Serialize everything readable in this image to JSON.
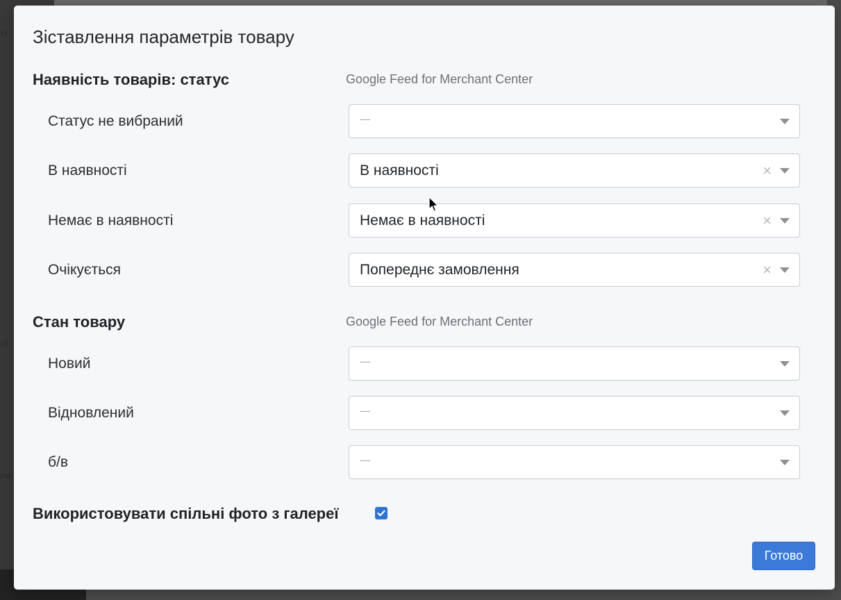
{
  "backdrop": {
    "edge_text_1": "ті",
    "edge_text_2": "лі",
    "edge_text_3": "ри"
  },
  "modal": {
    "title": "Зіставлення параметрів товару",
    "availability_section": {
      "title": "Наявність товарів: статус",
      "source": "Google Feed for Merchant Center",
      "rows": [
        {
          "label": "Статус не вибраний",
          "value": "",
          "placeholder": "----"
        },
        {
          "label": "В наявності",
          "value": "В наявності",
          "placeholder": ""
        },
        {
          "label": "Немає в наявності",
          "value": "Немає в наявності",
          "placeholder": ""
        },
        {
          "label": "Очікується",
          "value": "Попереднє замовлення",
          "placeholder": ""
        }
      ]
    },
    "condition_section": {
      "title": "Стан товару",
      "source": "Google Feed for Merchant Center",
      "rows": [
        {
          "label": "Новий",
          "value": "",
          "placeholder": "----"
        },
        {
          "label": "Відновлений",
          "value": "",
          "placeholder": "----"
        },
        {
          "label": "б/в",
          "value": "",
          "placeholder": "----"
        }
      ]
    },
    "gallery_checkbox": {
      "label": "Використовувати спільні фото з галереї",
      "checked": true
    },
    "done_button": "Готово",
    "clear_symbol": "×"
  },
  "colors": {
    "accent": "#3b7ad9",
    "checkbox": "#2f74d0",
    "modal_bg": "#f6f7f8"
  }
}
